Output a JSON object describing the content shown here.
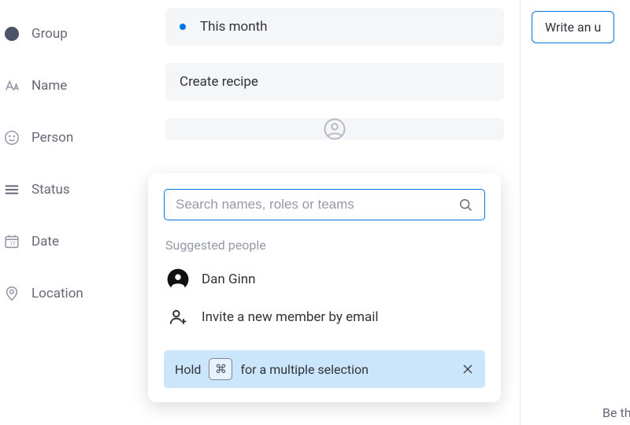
{
  "sidebar": {
    "items": [
      {
        "label": "Group"
      },
      {
        "label": "Name"
      },
      {
        "label": "Person"
      },
      {
        "label": "Status"
      },
      {
        "label": "Date"
      },
      {
        "label": "Location"
      }
    ]
  },
  "main": {
    "group_value": "This month",
    "name_value": "Create recipe"
  },
  "person_popover": {
    "search_placeholder": "Search names, roles or teams",
    "suggested_label": "Suggested people",
    "people": [
      {
        "name": "Dan Ginn"
      }
    ],
    "invite_label": "Invite a new member by email",
    "tip_prefix": "Hold",
    "tip_key": "⌘",
    "tip_suffix": "for a multiple selection"
  },
  "right": {
    "write_chip": "Write an u",
    "be_the": "Be the"
  }
}
